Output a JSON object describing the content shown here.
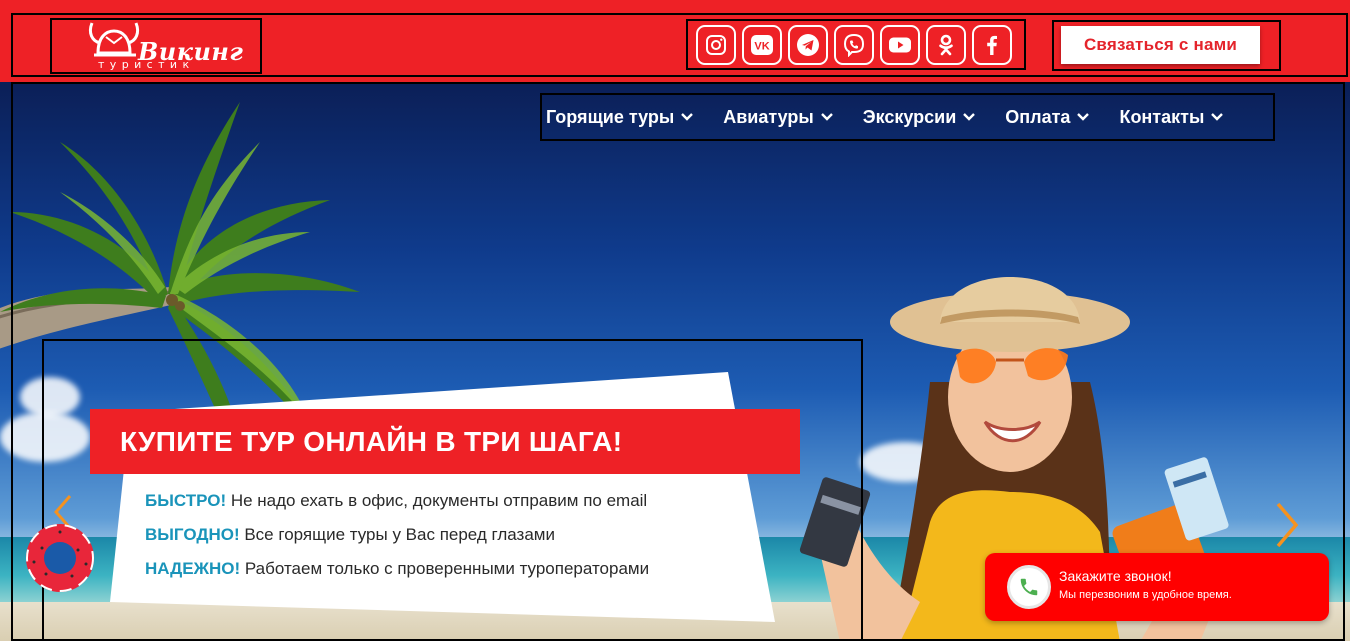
{
  "brand": {
    "name": "Викинг",
    "tagline": "туристик"
  },
  "social": [
    {
      "name": "instagram-icon"
    },
    {
      "name": "vk-icon"
    },
    {
      "name": "telegram-icon"
    },
    {
      "name": "viber-icon"
    },
    {
      "name": "youtube-icon"
    },
    {
      "name": "odnoklassniki-icon"
    },
    {
      "name": "facebook-icon"
    }
  ],
  "header": {
    "contact_label": "Связаться с нами"
  },
  "nav": {
    "items": [
      {
        "label": "Горящие туры"
      },
      {
        "label": "Авиатуры"
      },
      {
        "label": "Экскурсии"
      },
      {
        "label": "Оплата"
      },
      {
        "label": "Контакты"
      }
    ]
  },
  "hero": {
    "headline": "КУПИТЕ ТУР ОНЛАЙН В ТРИ ШАГА!",
    "features": [
      {
        "lead": "БЫСТРО!",
        "text": "Не надо ехать в офис, документы отправим по email"
      },
      {
        "lead": "ВЫГОДНО!",
        "text": "Все горящие туры у Вас перед глазами"
      },
      {
        "lead": "НАДЕЖНО!",
        "text": "Работаем только с проверенными туроператорами"
      }
    ]
  },
  "callback": {
    "title": "Закажите звонок!",
    "subtitle": "Мы перезвоним в удобное время."
  },
  "colors": {
    "brand_red": "#ee2126",
    "accent_blue": "#1a94ba",
    "callback_red": "#ff0000",
    "slider_arrow": "#f5921f"
  }
}
